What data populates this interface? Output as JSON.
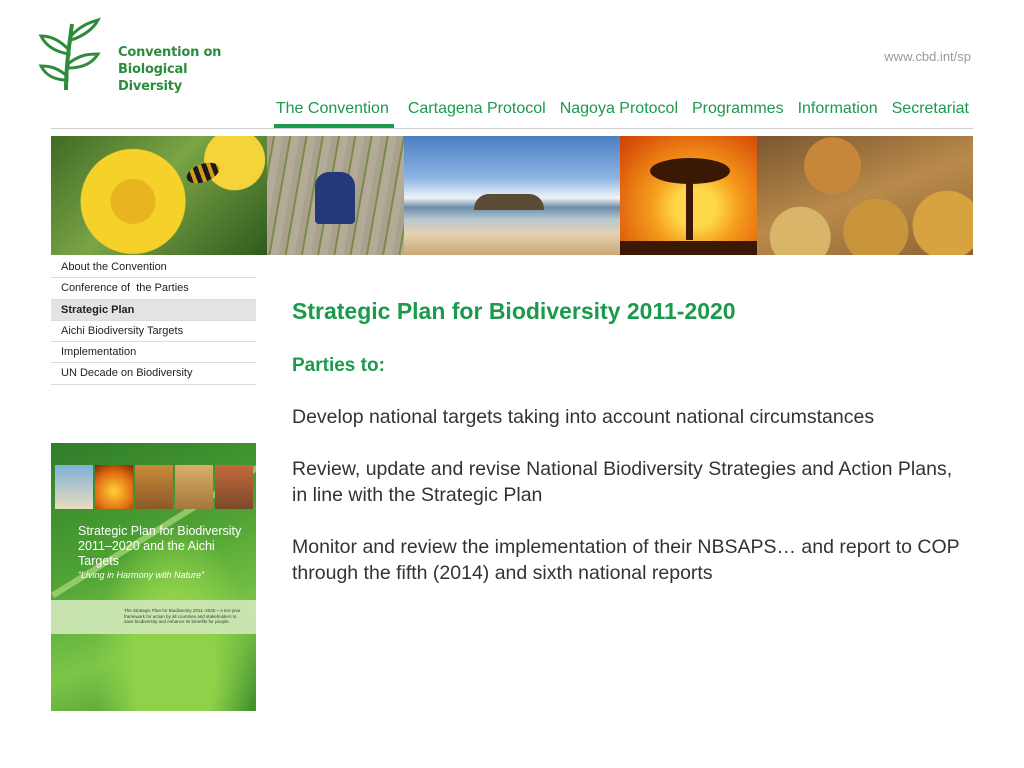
{
  "logo": {
    "line1": "Convention on",
    "line2": "Biological Diversity"
  },
  "site_url": "www.cbd.int/sp",
  "topnav": [
    "The Convention",
    "Cartagena Protocol",
    "Nagoya Protocol",
    "Programmes",
    "Information",
    "Secretariat"
  ],
  "leftnav": [
    "About the Convention",
    "Conference of  the Parties",
    "Strategic Plan",
    "Aichi Biodiversity Targets",
    "Implementation",
    "UN Decade on Biodiversity"
  ],
  "cover": {
    "title": "Strategic Plan for Biodiversity 2011–2020 and the Aichi Targets",
    "subtitle": "“Living in Harmony with Nature”",
    "blurb": "The Strategic Plan for Biodiversity 2011–2020 – A ten-year framework for action by all countries and stakeholders to save biodiversity and enhance its benefits for people."
  },
  "main": {
    "title": "Strategic Plan for Biodiversity 2011-2020",
    "subtitle": "Parties to:",
    "paragraphs": [
      "Develop national targets taking into account national circumstances",
      "Review, update and revise National Biodiversity Strategies and Action Plans, in line with the Strategic Plan",
      "Monitor and review the implementation of their NBSAPS… and report to COP through the fifth (2014) and sixth national reports"
    ]
  },
  "colors": {
    "brand_green": "#1b9a4c",
    "url_gray": "#9a9a9a",
    "active_nav_bg": "#e3e3e3"
  },
  "icons": [
    "cbd-leaf-logo-icon"
  ]
}
